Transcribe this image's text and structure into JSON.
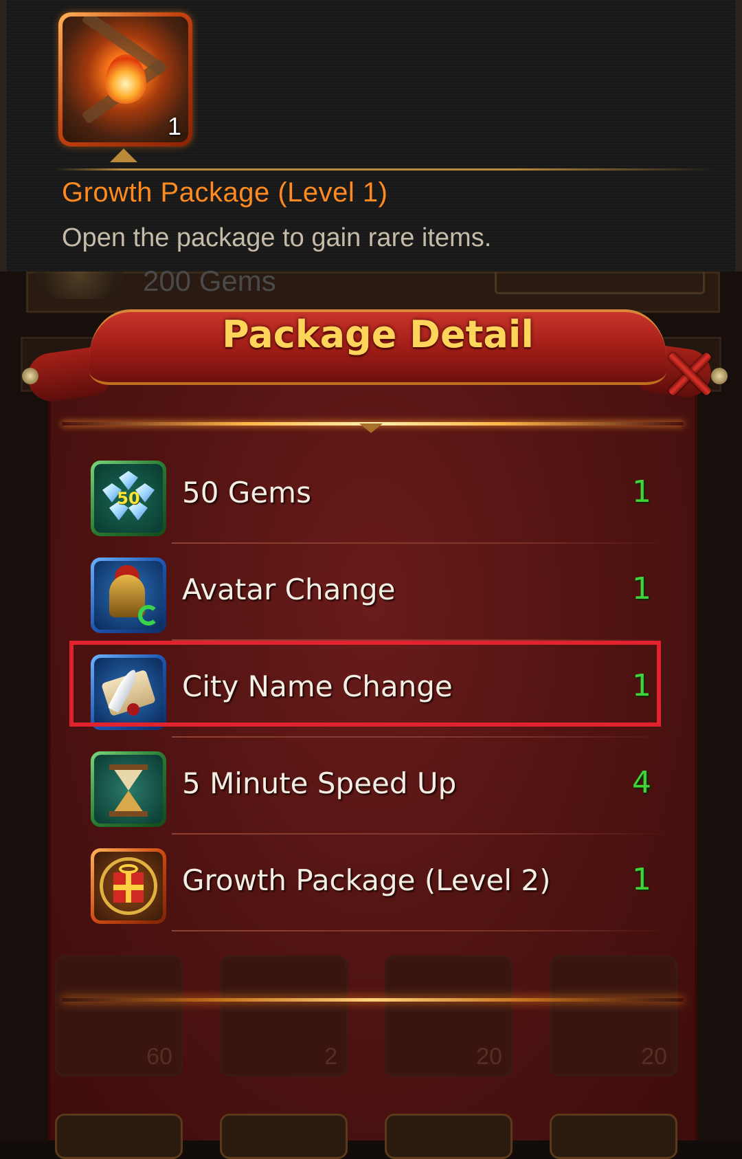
{
  "tooltip": {
    "item_count": "1",
    "title": "Growth Package (Level 1)",
    "description": "Open the package to gain rare items."
  },
  "background": {
    "gems_label": "200 Gems",
    "slot_counts": [
      "60",
      "2",
      "20",
      "20"
    ]
  },
  "dialog": {
    "title": "Package Detail",
    "items": [
      {
        "name": "50 Gems",
        "quantity": "1",
        "icon": "gems-icon",
        "badge": "50"
      },
      {
        "name": "Avatar Change",
        "quantity": "1",
        "icon": "helmet-icon"
      },
      {
        "name": "City Name Change",
        "quantity": "1",
        "icon": "scroll-quill-icon"
      },
      {
        "name": "5 Minute Speed Up",
        "quantity": "4",
        "icon": "hourglass-icon"
      },
      {
        "name": "Growth Package (Level 2)",
        "quantity": "1",
        "icon": "gift-icon"
      }
    ]
  },
  "colors": {
    "quantity": "#3fd43a",
    "title": "#ffd45a",
    "tooltip_title": "#ff8a1f",
    "highlight": "#e0232f"
  }
}
